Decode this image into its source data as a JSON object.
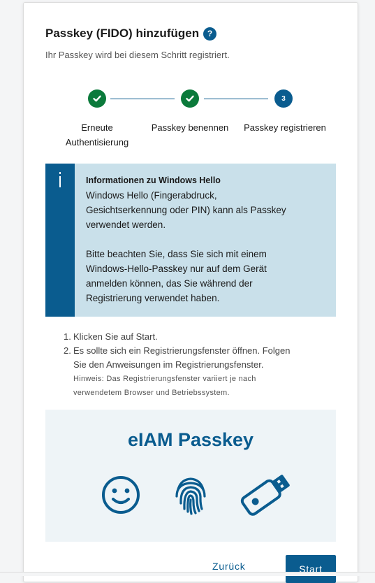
{
  "dialog": {
    "title": "Passkey (FIDO) hinzufügen",
    "help_icon": "?",
    "subtitle": "Ihr Passkey wird bei diesem Schritt registriert."
  },
  "stepper": {
    "steps": [
      {
        "label_line1": "Erneute",
        "label_line2": "Authentisierung",
        "state": "done",
        "icon": "check-icon"
      },
      {
        "label_line1": "Passkey benennen",
        "label_line2": "",
        "state": "done",
        "icon": "check-icon"
      },
      {
        "label_line1": "Passkey registrieren",
        "label_line2": "",
        "state": "active",
        "number": "3"
      }
    ]
  },
  "info_box": {
    "icon": "i",
    "heading": "Informationen zu Windows Hello",
    "lines_para1": [
      "Windows Hello (Fingerabdruck,",
      "Gesichtserkennung oder PIN) kann als Passkey",
      "verwendet werden."
    ],
    "lines_para2": [
      "Bitte beachten Sie, dass Sie sich mit einem",
      "Windows-Hello-Passkey nur auf dem Gerät",
      "anmelden können, das Sie während der",
      "Registrierung verwendet haben."
    ]
  },
  "instructions": {
    "items": [
      {
        "num": "1.",
        "lines": [
          "Klicken Sie auf Start."
        ]
      },
      {
        "num": "2.",
        "lines": [
          "Es sollte sich ein Registrierungsfenster öffnen. Folgen",
          "Sie den Anweisungen im Registrierungsfenster."
        ]
      }
    ],
    "hint_lines": [
      "Hinweis: Das Registrierungsfenster variiert je nach",
      "verwendetem Browser und Betriebssystem."
    ]
  },
  "banner": {
    "title": "eIAM Passkey",
    "icons": [
      "smiley-face-icon",
      "fingerprint-icon",
      "usb-security-key-icon"
    ]
  },
  "buttons": {
    "back": "Zurück",
    "start": "Start"
  },
  "colors": {
    "primary": "#0a5c8f",
    "success": "#0b7a3b",
    "info_bg": "#c9e0ea",
    "banner_bg": "#eef4f7"
  }
}
